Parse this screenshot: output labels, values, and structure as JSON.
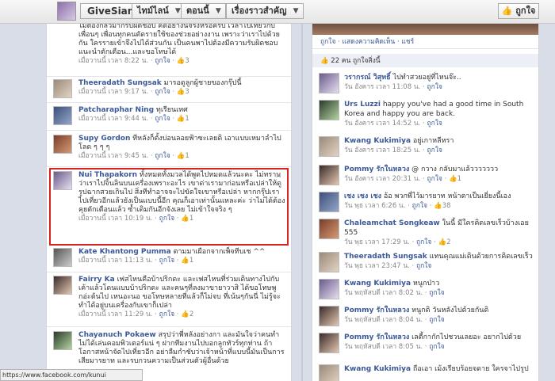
{
  "header": {
    "page_name": "GiveSiam",
    "nav": [
      "ไทม์ไลน์",
      "ตอนนี้",
      "เรื่องราวสำคัญ"
    ],
    "like_button": "ถูกใจ",
    "like_icon": "thumbs-up-icon"
  },
  "left_comments": [
    {
      "name": "",
      "text": "ไม่ต้องกลัวมากรับผิดชอบ คิดอย่างนี้จริงหรือครับ เวลาไปเที่ยวกับเพื่อนๆ เพื่อนทุกคนตัดรายใช้ของช่วยอย่างงาน เพราะว่าเราไปด้วยกัน ใครรายเข้าจึงไปได้ส่วนกัน เป็นคนพาไปต้องมีความรับผิดชอบ แนะนำตักเตือน...และขอโทษได้",
      "time": "เมื่อวานนี้ เวลา 8:22 น.",
      "like": "ถูกใจ",
      "count": "3"
    },
    {
      "name": "Theeradath Sungsak",
      "text": "มารอดูลูกผู้ชายของกรุ๊ปนี้",
      "time": "เมื่อวานนี้ เวลา 9:17 น.",
      "like": "ถูกใจ",
      "count": "3"
    },
    {
      "name": "Patcharaphar Ning",
      "text": "ทุเรียนเทศ",
      "time": "เมื่อวานนี้ เวลา 9:44 น.",
      "like": "ถูกใจ",
      "count": "1"
    },
    {
      "name": "Supy Gordon",
      "text": "ทีหลังก็ตั้งบ่อนลอยฟ้าซะเลยดิ เอาแบบเหมาลำไปโลด ๆ ๆ ๆ",
      "time": "เมื่อวานนี้ เวลา 9:45 น.",
      "like": "ถูกใจ",
      "count": "1"
    },
    {
      "name": "Nui Thapakorn",
      "text": "ทั้งหมดทั้งมวลได้พูดไปหมดแล้วนะคะ ไม่ทราบว่าเราไปจิ้นลินบนเครื่องเพราะอะไร เขาด่าเรามาก่อนหรือเปล่าให้ดูรูปฉากสวยเกินไป สิ่งทีทำอาจจะไปขัดใจเขาหรือเปล่า หากกรุ๊ปเราไปเที่ยวอีกแล้วยังเป็นแบบนี้อีก คุณก็เอาเท่านั้นแหละค่ะ ว่าไม่ได้ต้องคุยตักเตือนแล้ว ซ้ำเดิมกันอีกจังเลย ไม่เข้าใจจริง ๆ",
      "time": "เมื่อวานนี้ เวลา 10:19 น.",
      "like": "ถูกใจ",
      "count": "1"
    },
    {
      "name": "Kate Khantong Pumma",
      "text": "ตามมาเผือกจากเพ็จทีบเช ^^",
      "time": "เมื่อวานนี้ เวลา 11:13 น.",
      "like": "ถูกใจ",
      "count": "1"
    },
    {
      "name": "Fairry Ka",
      "text": "เฟสไหนคือบ้าปริกดะ และเฟสไหนที่ร่วมเดินทางไปกับเค้าแล้วโดนแบบบ้าปริกดะ และคนๆที่ลงมาขายาวาสิ ได้ขอโทษพูกอ่ะต้นไป เหนอะนอ ขอโทษหลายที่แล้วก็ไม่จบ ที่เน้นๆกันนี่ ไม่รู้จะทำได้อยู่บนเครื่องกับเขาก็เปล่า",
      "time": "เมื่อวานนี้ เวลา 11:29 น.",
      "like": "ถูกใจ",
      "count": "2"
    },
    {
      "name": "Chayanuch Pokaew",
      "text": "สรุปว่าพี่หลังอย่างกา และมันใจว่าคนทำไม่ได้เล่นคอมพิวเตอร์แน่ ๆ ฝากทีมงานไปบอกลูกทัวร์ทุกท่าน ถ้าโอกาสหน้าจัดไปเที่ยวอีก อย่าลืมกำชับว่าเจ้าหน้าที่แบบนี้มันเป็นการเสียมารยาท และรบกวนความเป็นส่วนตัวผู้อื่นด้วย",
      "time": "",
      "like": "",
      "count": ""
    }
  ],
  "right_panel": {
    "actions": [
      "ถูกใจ",
      "แสดงความคิดเห็น",
      "แชร์"
    ],
    "likes_summary": "22 คน ถูกใจสิ่งนี้",
    "comments": [
      {
        "name": "วรากรณ์ วิสุทธิ์",
        "text": "ไปทำสวยอยู่ที่ไหนจ๊ะ..",
        "time": "วัน อังคาร เวลา 11:08 น.",
        "like": "ถูกใจ",
        "count": ""
      },
      {
        "name": "Urs Luzzi",
        "text": "happy you've had a good time in South Korea and happy you are back.",
        "time": "วัน อังคาร เวลา 14:52 น.",
        "like": "ถูกใจ",
        "count": ""
      },
      {
        "name": "Kwang Kukimiya",
        "text": "อยู่เกาหลีหรา",
        "time": "วัน อังคาร เวลา 18:25 น.",
        "like": "ถูกใจ",
        "count": ""
      },
      {
        "name": "Pommy รักในหลวง",
        "text": "@ กวาง กลับมาแล้ววววววว",
        "time": "วัน อังคาร เวลา 20:31 น.",
        "like": "ถูกใจ",
        "count": "1"
      },
      {
        "name": "เชง เชง เชง",
        "text": "อ้อ พวกพี่ไว้มารยาท หน้าตาเป็นเยี่ยงนี้เอง",
        "time": "วัน พุธ เวลา 6:26 น.",
        "like": "ถูกใจ",
        "count": "38"
      },
      {
        "name": "Chaleamchat Songkeaw",
        "text": "ในนี้ มีใครคิดเลขเร็วบ้างเอย 555",
        "time": "วัน พุธ เวลา 17:29 น.",
        "like": "ถูกใจ",
        "count": "2"
      },
      {
        "name": "Theeradath Sungsak",
        "text": "แทนคุณแม่เดินด้วยการคิดเลขเร็ว",
        "time": "วัน พุธ เวลา 23:47 น.",
        "like": "ถูกใจ",
        "count": ""
      },
      {
        "name": "Kwang Kukimiya",
        "text": "หนูกป่าว",
        "time": "วัน พฤหัสบดี เวลา 8:02 น.",
        "like": "ถูกใจ",
        "count": ""
      },
      {
        "name": "Pommy รักในหลวง",
        "text": "หนูกดิ วันหลังไปด้วยกันดิ",
        "time": "วัน พฤหัสบดี เวลา 8:04 น.",
        "like": "ถูกใจ",
        "count": ""
      },
      {
        "name": "Pommy รักในหลวง",
        "text": "เลตี้กากักไปชวนเลยอะ อยากไปด้วย",
        "time": "วัน พฤหัสบดี เวลา 8:05 น.",
        "like": "ถูกใจ",
        "count": ""
      },
      {
        "name": "Kwang Kukimiya",
        "text": "ถือเอา เม้งเรียบร้อยจดาย ใครจาไปรูป",
        "time": "",
        "like": "",
        "count": ""
      }
    ]
  },
  "status_bar": "https://www.facebook.com/kunui"
}
